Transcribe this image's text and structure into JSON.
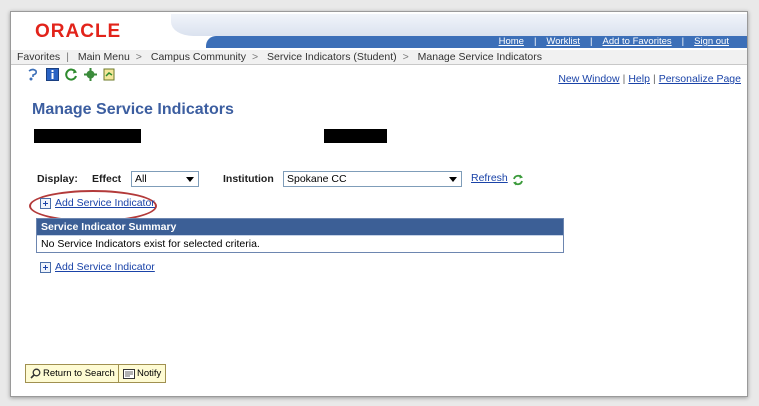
{
  "header": {
    "logo_text": "ORACLE",
    "links": [
      "Home",
      "Worklist",
      "Add to Favorites",
      "Sign out"
    ]
  },
  "menu": {
    "items": [
      "Favorites",
      "Main Menu",
      "Campus Community",
      "Service Indicators (Student)",
      "Manage Service Indicators"
    ]
  },
  "toolbar": {
    "icons": [
      "help-icon",
      "info-icon",
      "refresh-icon",
      "gear-icon",
      "report-icon"
    ]
  },
  "page_links": {
    "new_window": "New Window",
    "help": "Help",
    "personalize": "Personalize Page"
  },
  "page": {
    "title": "Manage Service Indicators"
  },
  "filters": {
    "display_label": "Display:",
    "effect_label": "Effect",
    "effect_value": "All",
    "institution_label": "Institution",
    "institution_value": "Spokane CC",
    "refresh_label": "Refresh"
  },
  "add_link_top": "Add Service Indicator",
  "grid": {
    "title": "Service Indicator Summary",
    "empty_message": "No Service Indicators exist for selected criteria."
  },
  "add_link_bottom": "Add Service Indicator",
  "buttons": {
    "return_to_search": "Return to Search",
    "notify": "Notify"
  },
  "colors": {
    "accent_blue": "#3c6fb8",
    "grid_header": "#3c5f96",
    "oracle_red": "#e2231a",
    "annotation_oval": "#b33a3a"
  }
}
